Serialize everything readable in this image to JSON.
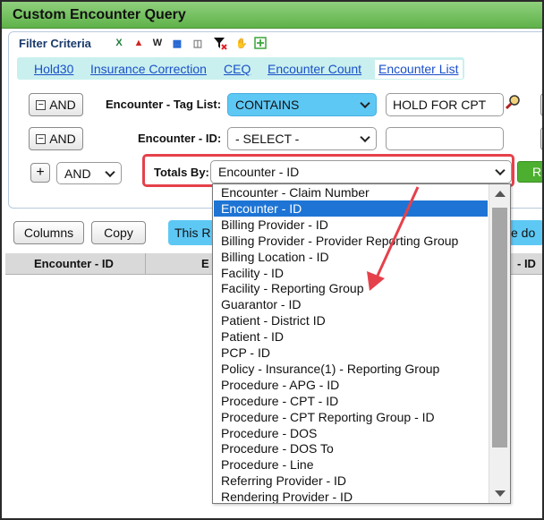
{
  "window": {
    "title": "Custom Encounter Query"
  },
  "filter": {
    "label": "Filter Criteria",
    "toolbar_icons": [
      "excel-icon",
      "pdf-icon",
      "word-icon",
      "save-icon",
      "trash-icon",
      "clear-filter-icon",
      "hand-icon",
      "add-icon"
    ]
  },
  "tabs": [
    {
      "label": "Hold30"
    },
    {
      "label": "Insurance Correction"
    },
    {
      "label": "CEQ"
    },
    {
      "label": "Encounter Count"
    },
    {
      "label": "Encounter List",
      "active": true
    }
  ],
  "rows": {
    "row1": {
      "and_label": "AND",
      "field_label": "Encounter - Tag List:",
      "operator": "CONTAINS",
      "value": "HOLD FOR CPT"
    },
    "row2": {
      "and_label": "AND",
      "field_label": "Encounter - ID:",
      "operator": "- SELECT -",
      "value": ""
    },
    "row3": {
      "plus_label": "+",
      "and_select": "AND",
      "totals_label": "Totals By:",
      "totals_value": "Encounter - ID",
      "run_label": "R"
    }
  },
  "bottom": {
    "columns_button": "Columns",
    "copy_button": "Copy",
    "info_text": "This R",
    "info_text_right": "se do",
    "grid_headers": [
      "Encounter - ID",
      "E",
      "- ID"
    ]
  },
  "dropdown": {
    "selected": "Encounter - ID",
    "options": [
      "Encounter - Claim Number",
      "Encounter - ID",
      "Billing Provider - ID",
      "Billing Provider - Provider Reporting Group",
      "Billing Location - ID",
      "Facility - ID",
      "Facility - Reporting Group",
      "Guarantor - ID",
      "Patient - District ID",
      "Patient - ID",
      "PCP - ID",
      "Policy - Insurance(1) - Reporting Group",
      "Procedure - APG - ID",
      "Procedure - CPT - ID",
      "Procedure - CPT Reporting Group - ID",
      "Procedure - DOS",
      "Procedure - DOS To",
      "Procedure - Line",
      "Referring Provider - ID",
      "Rendering Provider - ID"
    ]
  },
  "colors": {
    "titlebar": "#5fb24a",
    "tab_strip": "#c9f0ee",
    "operator_select": "#5ec8f5",
    "highlight": "#e5414b",
    "selected_option": "#1e74d4"
  }
}
